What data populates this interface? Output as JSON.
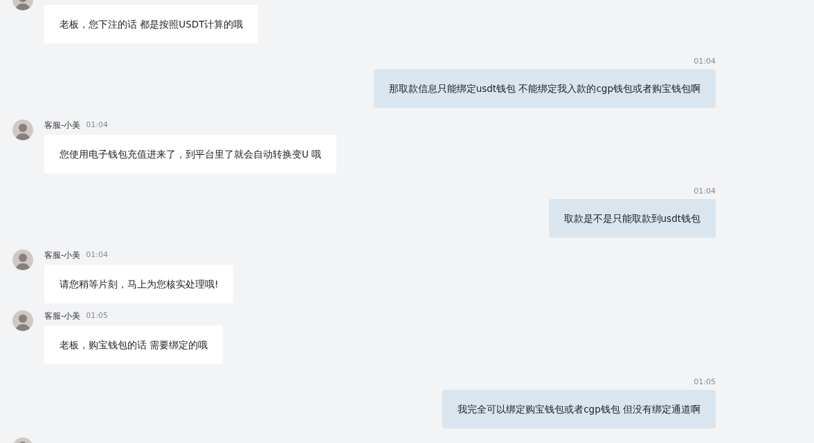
{
  "messages": [
    {
      "kind": "agent",
      "text": "老板，您下注的话 都是按照USDT计算的哦"
    },
    {
      "kind": "user",
      "time": "01:04",
      "text": "那取款信息只能绑定usdt钱包 不能绑定我入款的cgp钱包或者购宝钱包啊"
    },
    {
      "kind": "agent",
      "sender": "客服-小美",
      "time": "01:04",
      "text": "您使用电子钱包充值进来了，到平台里了就会自动转换变U 哦"
    },
    {
      "kind": "user",
      "time": "01:04",
      "text": "取款是不是只能取款到usdt钱包"
    },
    {
      "kind": "agent",
      "sender": "客服-小美",
      "time": "01:04",
      "text": "请您稍等片刻，马上为您核实处理哦!"
    },
    {
      "kind": "agent",
      "sender": "客服-小美",
      "time": "01:05",
      "text": "老板，购宝钱包的话 需要绑定的哦"
    },
    {
      "kind": "user",
      "time": "01:05",
      "text": "我完全可以绑定购宝钱包或者cgp钱包 但没有绑定通道啊"
    }
  ]
}
